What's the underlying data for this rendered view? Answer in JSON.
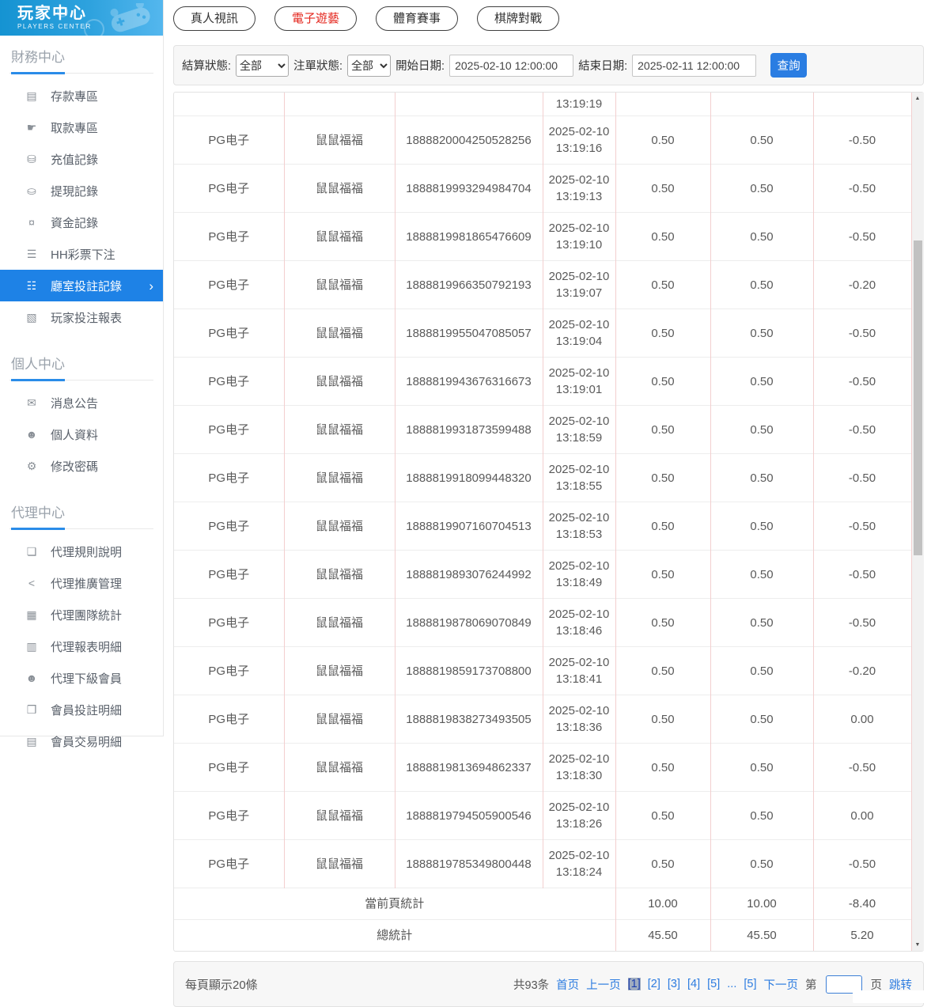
{
  "colors": {
    "accent_blue": "#1e82e6",
    "header_gradient_start": "#1593d2",
    "header_gradient_end": "#54b7ee",
    "active_tab_red": "#e4261d",
    "link_blue": "#2d7ce0",
    "table_column_border": "#f3cfcf"
  },
  "sidebar": {
    "logo": {
      "title": "玩家中心",
      "subtitle": "PLAYERS CENTER"
    },
    "sections": [
      {
        "title": "財務中心",
        "items": [
          {
            "id": "deposit",
            "icon": "bank-card-icon",
            "glyph": "▤",
            "label": "存款專區"
          },
          {
            "id": "withdraw",
            "icon": "hand-withdraw-icon",
            "glyph": "☛",
            "label": "取款專區"
          },
          {
            "id": "recharge-record",
            "icon": "coins-icon",
            "glyph": "⛁",
            "label": "充值記錄"
          },
          {
            "id": "withdraw-record",
            "icon": "wallet-icon",
            "glyph": "⛀",
            "label": "提現記錄"
          },
          {
            "id": "funds-record",
            "icon": "money-icon",
            "glyph": "¤",
            "label": "資金記錄"
          },
          {
            "id": "hh-lottery-bet",
            "icon": "list-icon",
            "glyph": "☰",
            "label": "HH彩票下注"
          },
          {
            "id": "room-bet-records",
            "icon": "bet-records-icon",
            "glyph": "☷",
            "label": "廳室投註記錄",
            "active": true,
            "arrow": "›"
          },
          {
            "id": "player-bet-report",
            "icon": "report-chart-icon",
            "glyph": "▧",
            "label": "玩家投注報表"
          }
        ]
      },
      {
        "title": "個人中心",
        "items": [
          {
            "id": "announcements",
            "icon": "bell-icon",
            "glyph": "✉",
            "label": "消息公告"
          },
          {
            "id": "profile",
            "icon": "user-icon",
            "glyph": "☻",
            "label": "個人資料"
          },
          {
            "id": "change-password",
            "icon": "gear-icon",
            "glyph": "⚙",
            "label": "修改密碼"
          }
        ]
      },
      {
        "title": "代理中心",
        "items": [
          {
            "id": "agent-rules",
            "icon": "document-icon",
            "glyph": "❏",
            "label": "代理規則說明"
          },
          {
            "id": "agent-promotion",
            "icon": "share-icon",
            "glyph": "<",
            "label": "代理推廣管理"
          },
          {
            "id": "agent-team-stats",
            "icon": "stats-icon",
            "glyph": "▦",
            "label": "代理團隊統計"
          },
          {
            "id": "agent-report-detail",
            "icon": "report-detail-icon",
            "glyph": "▥",
            "label": "代理報表明細"
          },
          {
            "id": "agent-sub-members",
            "icon": "members-icon",
            "glyph": "☻",
            "label": "代理下級會員"
          },
          {
            "id": "member-bet-detail",
            "icon": "clipboard-icon",
            "glyph": "❒",
            "label": "會員投註明細"
          },
          {
            "id": "member-trade-detail",
            "icon": "trade-list-icon",
            "glyph": "▤",
            "label": "會員交易明細"
          }
        ]
      }
    ]
  },
  "tabs": [
    {
      "id": "live-video",
      "label": "真人視訊",
      "active": false
    },
    {
      "id": "electronic-games",
      "label": "電子遊藝",
      "active": true
    },
    {
      "id": "sports",
      "label": "體育賽事",
      "active": false
    },
    {
      "id": "board-games",
      "label": "棋牌對戰",
      "active": false
    }
  ],
  "filters": {
    "settle_label": "結算狀態:",
    "settle_value": "全部",
    "order_label": "注單狀態:",
    "order_value": "全部",
    "start_label": "開始日期:",
    "start_value": "2025-02-10 12:00:00",
    "end_label": "結束日期:",
    "end_value": "2025-02-11 12:00:00",
    "search_label": "查詢"
  },
  "table": {
    "partial_row_time": "13:19:19",
    "rows": [
      {
        "game": "PG电子",
        "player": "鼠鼠福福",
        "order": "1888820004250528256",
        "date": "2025-02-10",
        "time": "13:19:16",
        "bet": "0.50",
        "valid": "0.50",
        "winloss": "-0.50"
      },
      {
        "game": "PG电子",
        "player": "鼠鼠福福",
        "order": "1888819993294984704",
        "date": "2025-02-10",
        "time": "13:19:13",
        "bet": "0.50",
        "valid": "0.50",
        "winloss": "-0.50"
      },
      {
        "game": "PG电子",
        "player": "鼠鼠福福",
        "order": "1888819981865476609",
        "date": "2025-02-10",
        "time": "13:19:10",
        "bet": "0.50",
        "valid": "0.50",
        "winloss": "-0.50"
      },
      {
        "game": "PG电子",
        "player": "鼠鼠福福",
        "order": "1888819966350792193",
        "date": "2025-02-10",
        "time": "13:19:07",
        "bet": "0.50",
        "valid": "0.50",
        "winloss": "-0.20"
      },
      {
        "game": "PG电子",
        "player": "鼠鼠福福",
        "order": "1888819955047085057",
        "date": "2025-02-10",
        "time": "13:19:04",
        "bet": "0.50",
        "valid": "0.50",
        "winloss": "-0.50"
      },
      {
        "game": "PG电子",
        "player": "鼠鼠福福",
        "order": "1888819943676316673",
        "date": "2025-02-10",
        "time": "13:19:01",
        "bet": "0.50",
        "valid": "0.50",
        "winloss": "-0.50"
      },
      {
        "game": "PG电子",
        "player": "鼠鼠福福",
        "order": "1888819931873599488",
        "date": "2025-02-10",
        "time": "13:18:59",
        "bet": "0.50",
        "valid": "0.50",
        "winloss": "-0.50"
      },
      {
        "game": "PG电子",
        "player": "鼠鼠福福",
        "order": "1888819918099448320",
        "date": "2025-02-10",
        "time": "13:18:55",
        "bet": "0.50",
        "valid": "0.50",
        "winloss": "-0.50"
      },
      {
        "game": "PG电子",
        "player": "鼠鼠福福",
        "order": "1888819907160704513",
        "date": "2025-02-10",
        "time": "13:18:53",
        "bet": "0.50",
        "valid": "0.50",
        "winloss": "-0.50"
      },
      {
        "game": "PG电子",
        "player": "鼠鼠福福",
        "order": "1888819893076244992",
        "date": "2025-02-10",
        "time": "13:18:49",
        "bet": "0.50",
        "valid": "0.50",
        "winloss": "-0.50"
      },
      {
        "game": "PG电子",
        "player": "鼠鼠福福",
        "order": "1888819878069070849",
        "date": "2025-02-10",
        "time": "13:18:46",
        "bet": "0.50",
        "valid": "0.50",
        "winloss": "-0.50"
      },
      {
        "game": "PG电子",
        "player": "鼠鼠福福",
        "order": "1888819859173708800",
        "date": "2025-02-10",
        "time": "13:18:41",
        "bet": "0.50",
        "valid": "0.50",
        "winloss": "-0.20"
      },
      {
        "game": "PG电子",
        "player": "鼠鼠福福",
        "order": "1888819838273493505",
        "date": "2025-02-10",
        "time": "13:18:36",
        "bet": "0.50",
        "valid": "0.50",
        "winloss": "0.00"
      },
      {
        "game": "PG电子",
        "player": "鼠鼠福福",
        "order": "1888819813694862337",
        "date": "2025-02-10",
        "time": "13:18:30",
        "bet": "0.50",
        "valid": "0.50",
        "winloss": "-0.50"
      },
      {
        "game": "PG电子",
        "player": "鼠鼠福福",
        "order": "1888819794505900546",
        "date": "2025-02-10",
        "time": "13:18:26",
        "bet": "0.50",
        "valid": "0.50",
        "winloss": "0.00"
      },
      {
        "game": "PG电子",
        "player": "鼠鼠福福",
        "order": "1888819785349800448",
        "date": "2025-02-10",
        "time": "13:18:24",
        "bet": "0.50",
        "valid": "0.50",
        "winloss": "-0.50"
      }
    ],
    "summary": [
      {
        "label": "當前頁統計",
        "bet": "10.00",
        "valid": "10.00",
        "winloss": "-8.40"
      },
      {
        "label": "總統計",
        "bet": "45.50",
        "valid": "45.50",
        "winloss": "5.20"
      }
    ]
  },
  "pagination": {
    "page_size_label": "每頁顯示20條",
    "total_label": "共93条",
    "first_label": "首页",
    "prev_label": "上一页",
    "pages": [
      {
        "label": "[1]",
        "current": true
      },
      {
        "label": "[2]",
        "current": false
      },
      {
        "label": "[3]",
        "current": false
      },
      {
        "label": "[4]",
        "current": false
      },
      {
        "label": "[5]",
        "current": false
      },
      {
        "label": "...",
        "current": false
      },
      {
        "label": "[5]",
        "current": false
      }
    ],
    "next_label": "下一页",
    "jump_before": "第",
    "jump_after": "页",
    "jump_button": "跳转",
    "jump_value": ""
  }
}
